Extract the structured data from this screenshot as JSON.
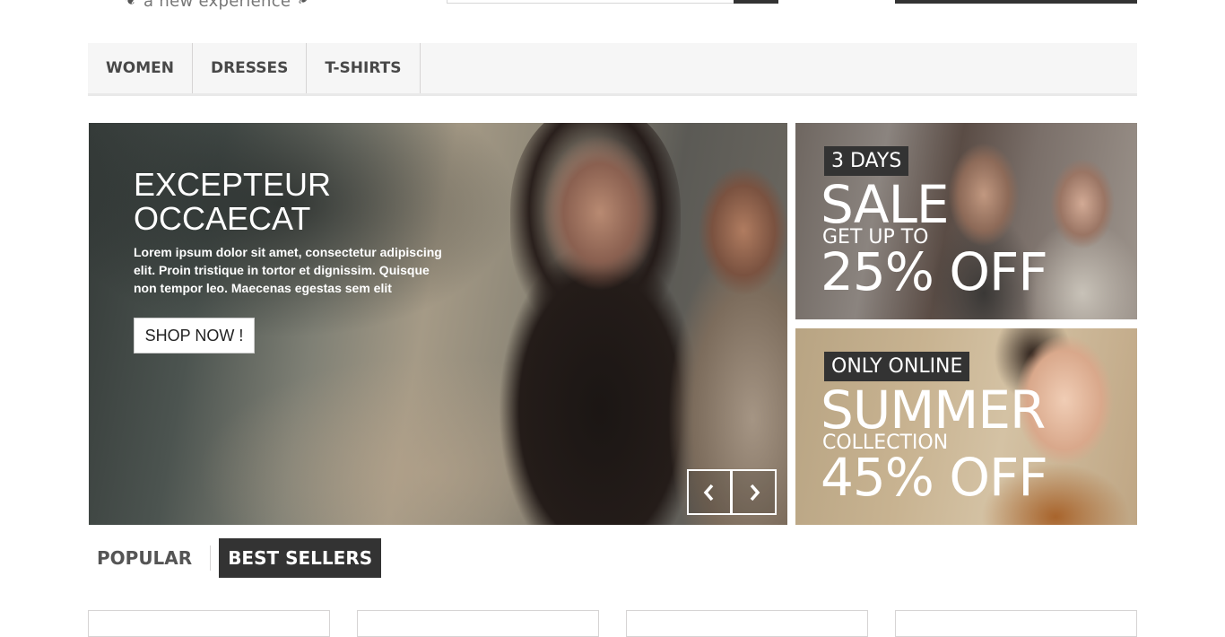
{
  "header": {
    "tagline": "a new experience"
  },
  "menu": {
    "items": [
      {
        "label": "WOMEN"
      },
      {
        "label": "DRESSES"
      },
      {
        "label": "T-SHIRTS"
      }
    ]
  },
  "slider": {
    "title_line1": "EXCEPTEUR",
    "title_line2": "OCCAECAT",
    "text": "Lorem ipsum dolor sit amet, consectetur adipiscing elit. Proin tristique in tortor et dignissim. Quisque non tempor leo. Maecenas egestas sem elit",
    "button_label": "SHOP NOW !",
    "prev_icon": "chevron-left-icon",
    "next_icon": "chevron-right-icon"
  },
  "banners": [
    {
      "badge": "3 DAYS",
      "headline": "SALE",
      "subline": "GET UP TO",
      "offer": "25% OFF"
    },
    {
      "badge": "ONLY ONLINE",
      "headline": "SUMMER",
      "subline": "COLLECTION",
      "offer": "45% OFF"
    }
  ],
  "tabs": [
    {
      "label": "POPULAR",
      "active": false
    },
    {
      "label": "BEST SELLERS",
      "active": true
    }
  ],
  "colors": {
    "dark": "#333333",
    "menu_bg": "#f6f6f6",
    "border": "#d6d4d4"
  }
}
